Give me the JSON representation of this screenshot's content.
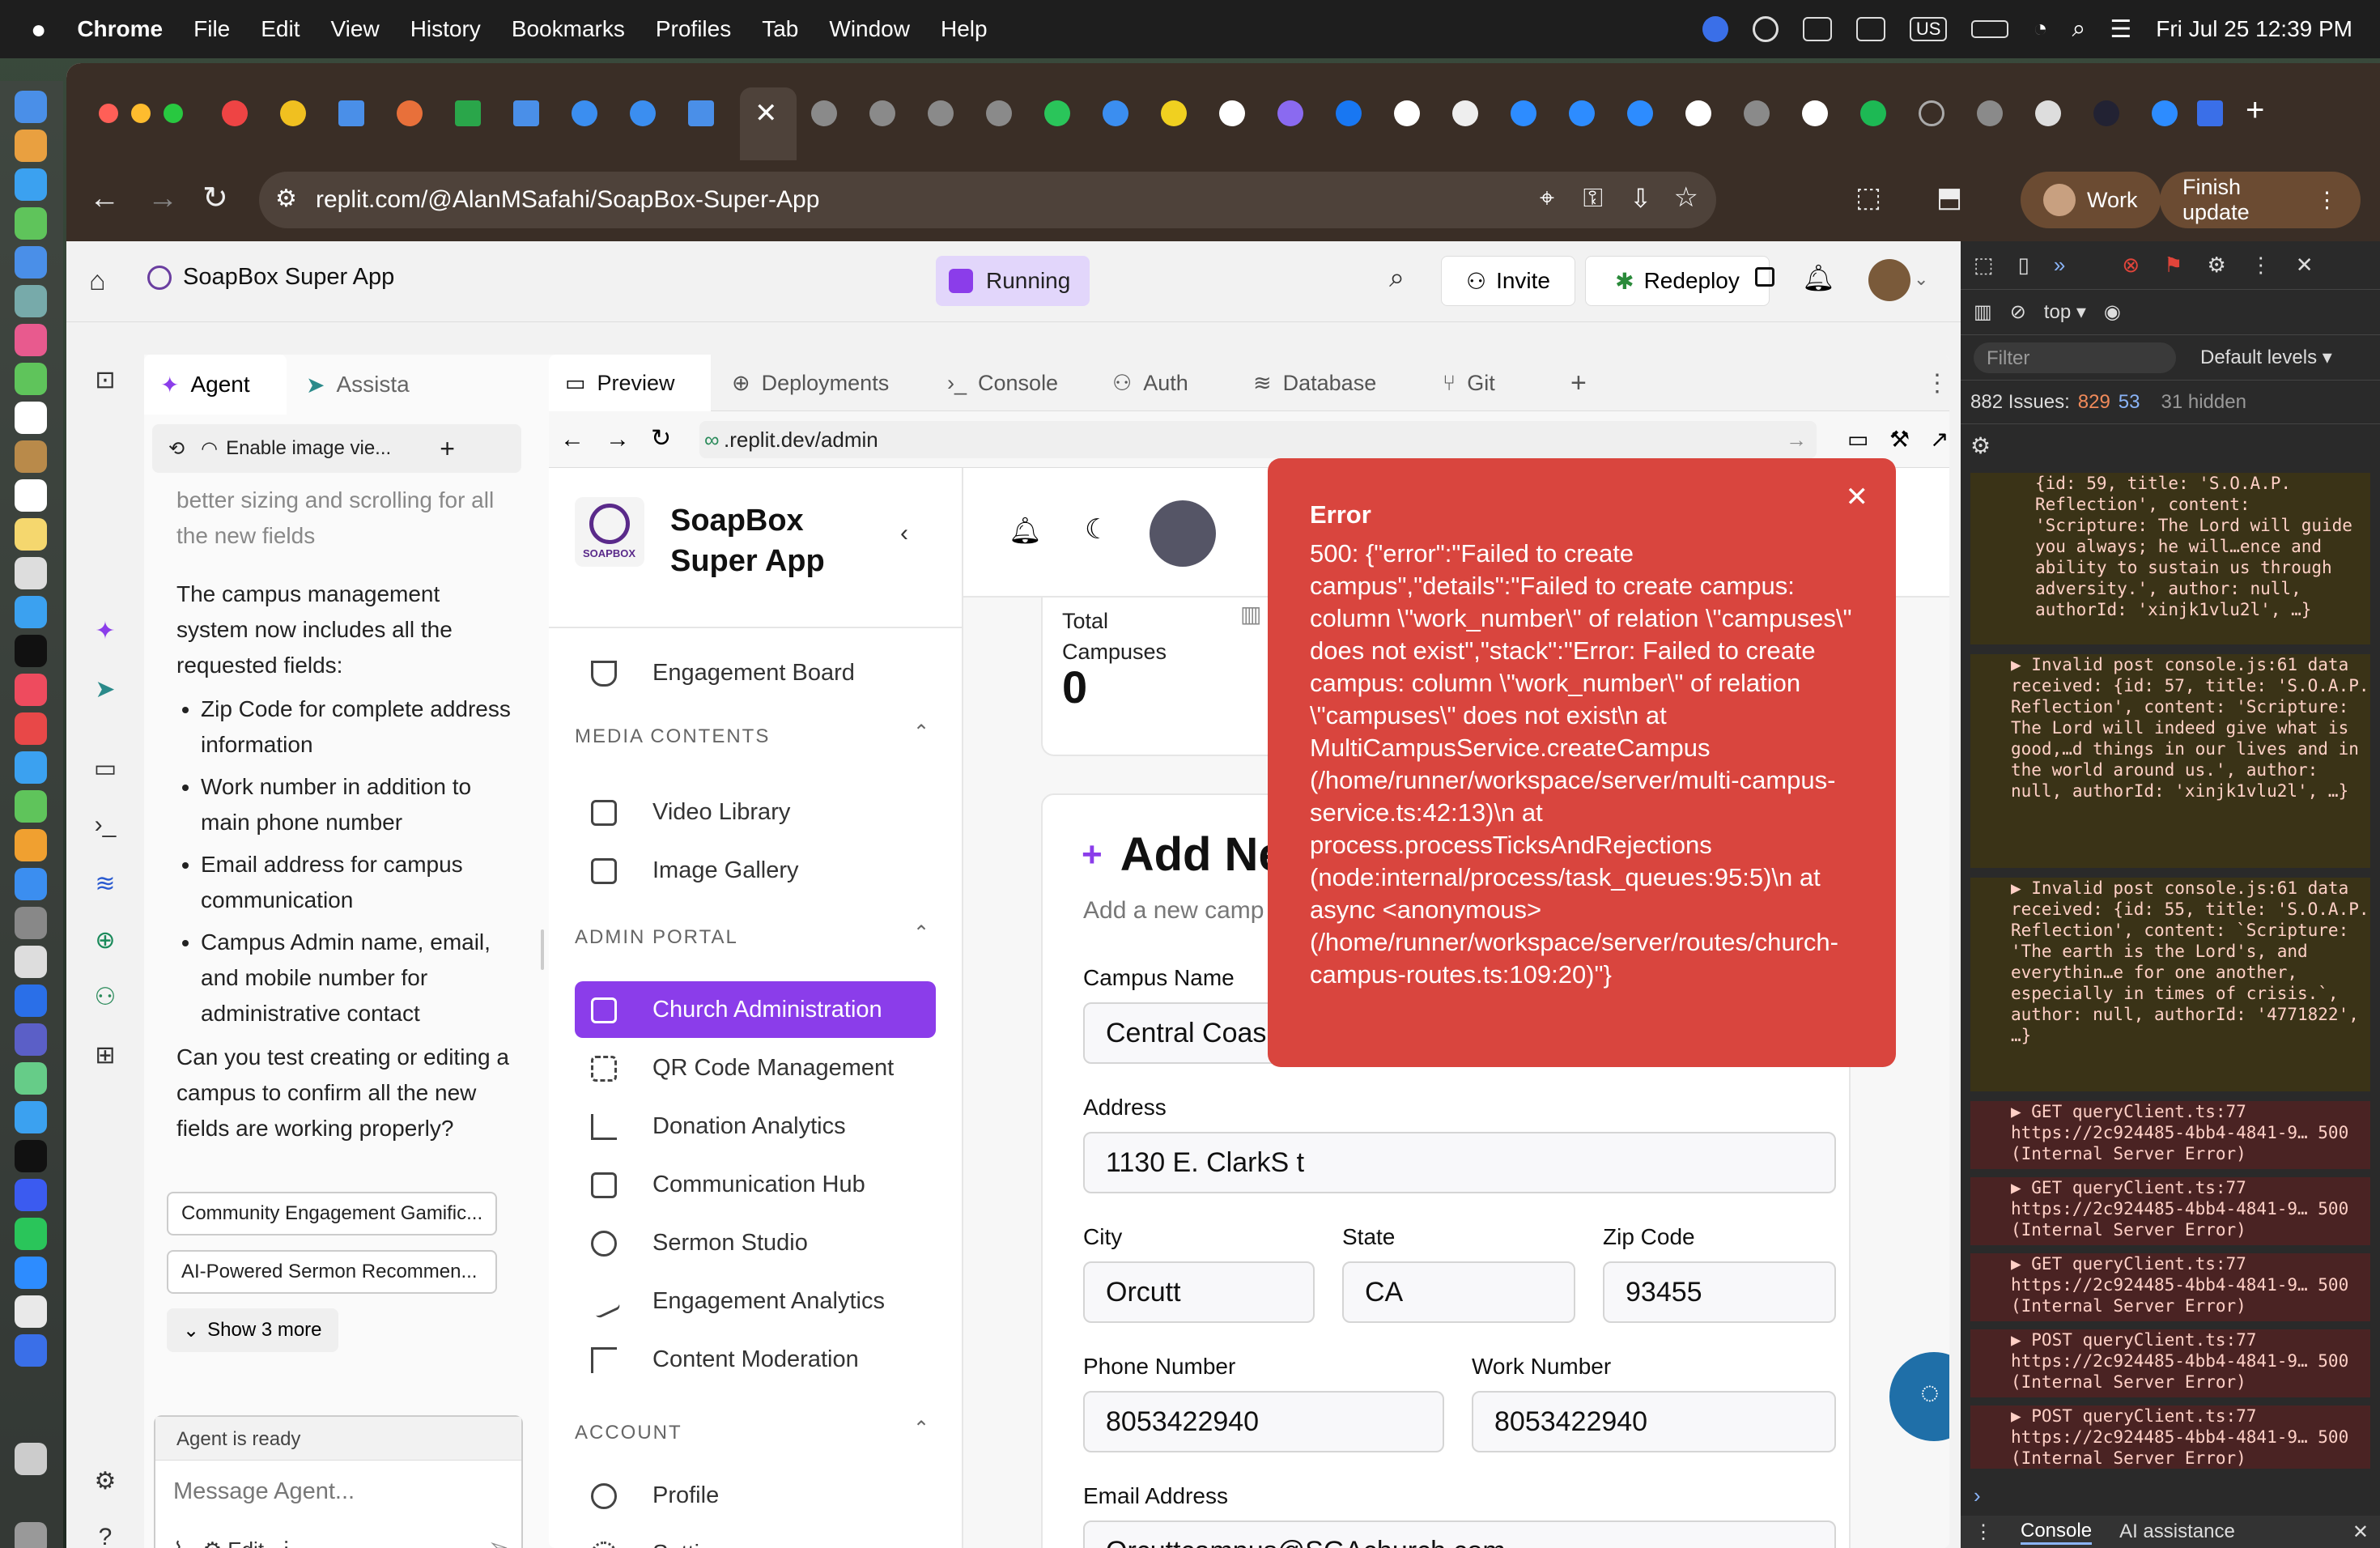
{
  "menubar": {
    "apple": "",
    "app": "Chrome",
    "items": [
      "File",
      "Edit",
      "View",
      "History",
      "Bookmarks",
      "Profiles",
      "Tab",
      "Window",
      "Help"
    ],
    "input": "US",
    "datetime": "Fri Jul 25  12:39 PM"
  },
  "browser": {
    "url": "replit.com/@AlanMSafahi/SoapBox-Super-App",
    "profile": "Work",
    "update": "Finish update"
  },
  "replit": {
    "project": "SoapBox Super App",
    "status": "Running",
    "invite": "Invite",
    "redeploy": "Redeploy",
    "agent_tabs": [
      "Agent",
      "Assista"
    ],
    "image_toggle": "Enable image vie...",
    "chat": {
      "cutoff": "better sizing and scrolling for all the new fields",
      "intro": "The campus management system now includes all the requested fields:",
      "bullets": [
        "Zip Code for complete address information",
        "Work number in addition to main phone number",
        "Email address for campus communication",
        "Campus Admin name, email, and mobile number for administrative contact"
      ],
      "question": "Can you test creating or editing a campus to confirm all the new fields are working properly?"
    },
    "suggestions": [
      "Community Engagement Gamific...",
      "AI-Powered Sermon Recommen..."
    ],
    "show_more": "Show 3 more",
    "agent_status": "Agent is ready",
    "message_placeholder": "Message Agent...",
    "edit": "Edit",
    "pane_tabs": [
      "Preview",
      "Deployments",
      "Console",
      "Auth",
      "Database",
      "Git"
    ],
    "preview_url": ".replit.dev/admin"
  },
  "site": {
    "title": "SoapBox Super App",
    "logo_text": "SOAPBOX",
    "sections": {
      "media": "MEDIA CONTENTS",
      "admin": "ADMIN PORTAL",
      "account": "ACCOUNT"
    },
    "nav": {
      "engagement_board": "Engagement Board",
      "video": "Video Library",
      "image": "Image Gallery",
      "church_admin": "Church Administration",
      "qr": "QR Code Management",
      "donation": "Donation Analytics",
      "comm": "Communication Hub",
      "sermon": "Sermon Studio",
      "eng_analytics": "Engagement Analytics",
      "moderation": "Content Moderation",
      "profile": "Profile",
      "settings": "Settings"
    },
    "stat": {
      "label": "Total Campuses",
      "value": "0"
    },
    "form": {
      "title": "Add Ne",
      "subtitle": "Add a new camp",
      "campus_name_label": "Campus Name",
      "campus_name": "Central Coas",
      "address_label": "Address",
      "address": "1130 E. ClarkS t",
      "city_label": "City",
      "city": "Orcutt",
      "state_label": "State",
      "state": "CA",
      "zip_label": "Zip Code",
      "zip": "93455",
      "phone_label": "Phone Number",
      "phone": "8053422940",
      "work_label": "Work Number",
      "work": "8053422940",
      "email_label": "Email Address",
      "email": "Orcuttcampus@SGAchurch.com"
    }
  },
  "error": {
    "title": "Error",
    "message": "500: {\"error\":\"Failed to create campus\",\"details\":\"Failed to create campus: column \\\"work_number\\\" of relation \\\"campuses\\\" does not exist\",\"stack\":\"Error: Failed to create campus: column \\\"work_number\\\" of relation \\\"campuses\\\" does not exist\\n at MultiCampusService.createCampus (/home/runner/workspace/server/multi-campus-service.ts:42:13)\\n at process.processTicksAndRejections (node:internal/process/task_queues:95:5)\\n at async <anonymous> (/home/runner/workspace/server/routes/church-campus-routes.ts:109:20)\"}"
  },
  "devtools": {
    "context": "top ▾",
    "filter": "Filter",
    "levels": "Default levels ▾",
    "issues": "882 Issues:",
    "issues_a": "829",
    "issues_b": "53",
    "hidden": "31 hidden",
    "logs": [
      {
        "kind": "warn",
        "text": "{id: 59, title: 'S.O.A.P. Reflection', content: 'Scripture: The Lord will guide you always; he will…ence and ability to sustain us through adversity.', author: null, authorId: 'xinjk1vlu2l', …}"
      },
      {
        "kind": "warn",
        "text": "▶ Invalid post  console.js:61 data received: {id: 57, title: 'S.O.A.P. Reflection', content: 'Scripture: The Lord will indeed give what is good,…d things in our lives and in the world around us.', author: null, authorId: 'xinjk1vlu2l', …}"
      },
      {
        "kind": "warn",
        "text": "▶ Invalid post  console.js:61 data received: {id: 55, title: 'S.O.A.P. Reflection', content: `Scripture: 'The earth is the Lord's, and everythin…e for one another, especially in times of crisis.`, author: null, authorId: '4771822', …}"
      },
      {
        "kind": "err",
        "text": "▶ GET  queryClient.ts:77 https://2c924485-4bb4-4841-9… 500 (Internal Server Error)"
      },
      {
        "kind": "err",
        "text": "▶ GET  queryClient.ts:77 https://2c924485-4bb4-4841-9… 500 (Internal Server Error)"
      },
      {
        "kind": "err",
        "text": "▶ GET  queryClient.ts:77 https://2c924485-4bb4-4841-9… 500 (Internal Server Error)"
      },
      {
        "kind": "err",
        "text": "▶ POST  queryClient.ts:77 https://2c924485-4bb4-4841-9… 500 (Internal Server Error)"
      },
      {
        "kind": "err",
        "text": "▶ POST  queryClient.ts:77 https://2c924485-4bb4-4841-9… 500 (Internal Server Error)"
      }
    ],
    "bottom_tabs": [
      "Console",
      "AI assistance"
    ]
  },
  "colors": {
    "accent": "#8b3dea",
    "error": "#d9453e",
    "running": "#e2d6fb"
  }
}
